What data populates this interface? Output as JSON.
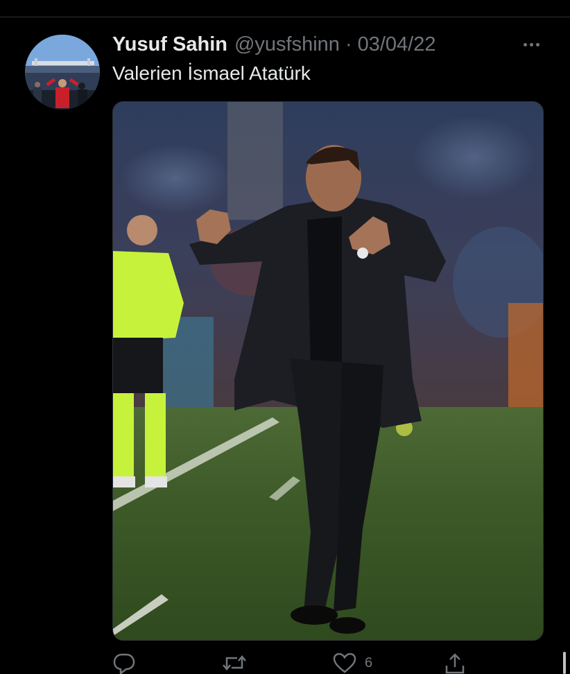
{
  "tweet": {
    "author": {
      "display_name": "Yusuf Sahin",
      "handle": "@yusfshinn",
      "avatar_icon": "profile-photo"
    },
    "separator": "·",
    "date": "03/04/22",
    "text": "Valerien İsmael Atatürk",
    "media": {
      "description_icon": "photo-coach-on-pitch"
    },
    "actions": {
      "reply_icon": "reply-icon",
      "retweet_icon": "retweet-icon",
      "like_icon": "heart-icon",
      "like_count": "6",
      "share_icon": "share-icon"
    }
  },
  "colors": {
    "background": "#000000",
    "primary_text": "#e7e9ea",
    "secondary_text": "#71767b",
    "divider": "#2f3336"
  }
}
